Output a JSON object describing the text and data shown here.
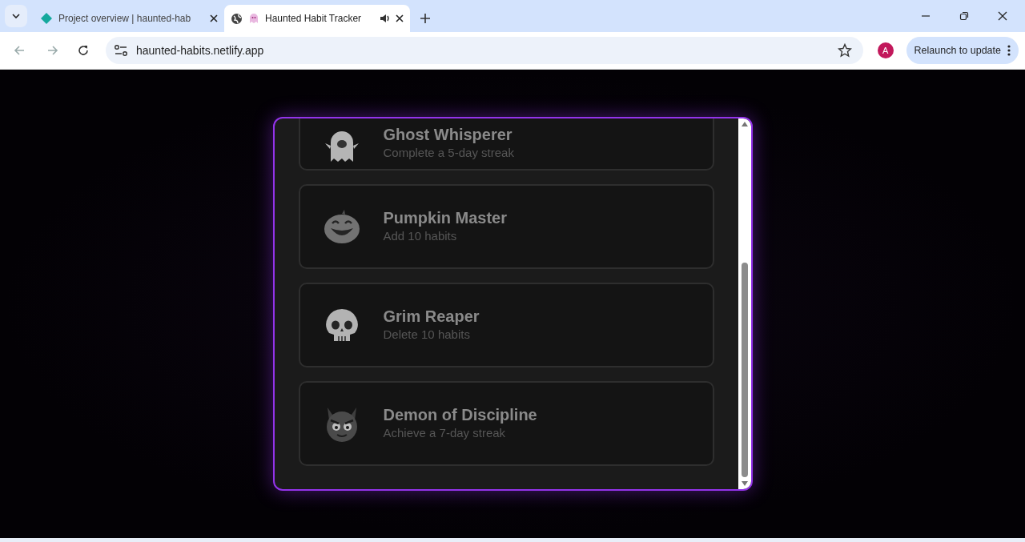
{
  "browser": {
    "tabs": [
      {
        "title": "Project overview | haunted-hab",
        "selected": false,
        "audio": false,
        "kind": "diamond"
      },
      {
        "title": "Haunted Habit Tracker",
        "selected": true,
        "audio": true,
        "kind": "ghost"
      }
    ],
    "address": "haunted-habits.netlify.app",
    "profile_initial": "A",
    "update_button": "Relaunch to update"
  },
  "achievements": [
    {
      "title": "Ghost Whisperer",
      "description": "Complete a 5-day streak",
      "kind": "ghost",
      "locked": true
    },
    {
      "title": "Pumpkin Master",
      "description": "Add 10 habits",
      "kind": "pumpkin",
      "locked": true
    },
    {
      "title": "Grim Reaper",
      "description": "Delete 10 habits",
      "kind": "skull",
      "locked": true
    },
    {
      "title": "Demon of Discipline",
      "description": "Achieve a 7-day streak",
      "kind": "demon",
      "locked": true
    }
  ]
}
